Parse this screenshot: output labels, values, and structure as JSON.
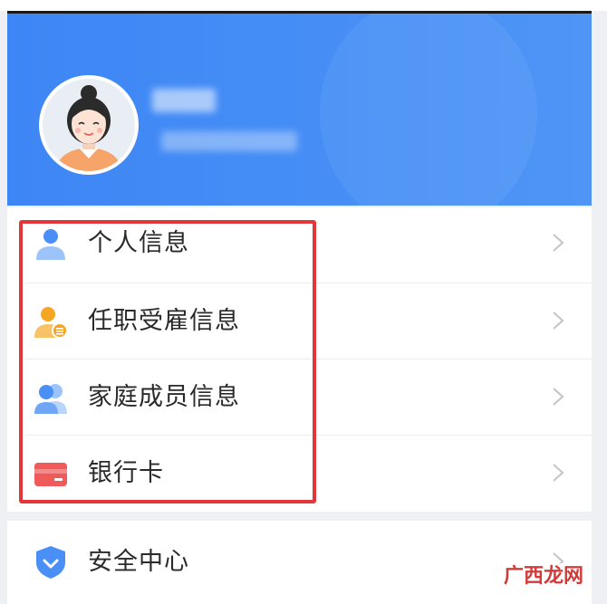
{
  "profile": {
    "name_redacted": "",
    "phone_redacted": ""
  },
  "menu": {
    "items": [
      {
        "label": "个人信息",
        "icon": "person-icon"
      },
      {
        "label": "任职受雇信息",
        "icon": "employment-icon"
      },
      {
        "label": "家庭成员信息",
        "icon": "family-icon"
      },
      {
        "label": "银行卡",
        "icon": "bank-card-icon"
      }
    ]
  },
  "security": {
    "label": "安全中心",
    "icon": "shield-icon"
  },
  "watermark": {
    "text": "广西龙网"
  },
  "colors": {
    "header_blue": "#3d86f5",
    "highlight_red": "#e2363a",
    "icon_blue": "#4a8ff5",
    "icon_orange": "#f5a623",
    "card_red": "#ef5a5a"
  }
}
